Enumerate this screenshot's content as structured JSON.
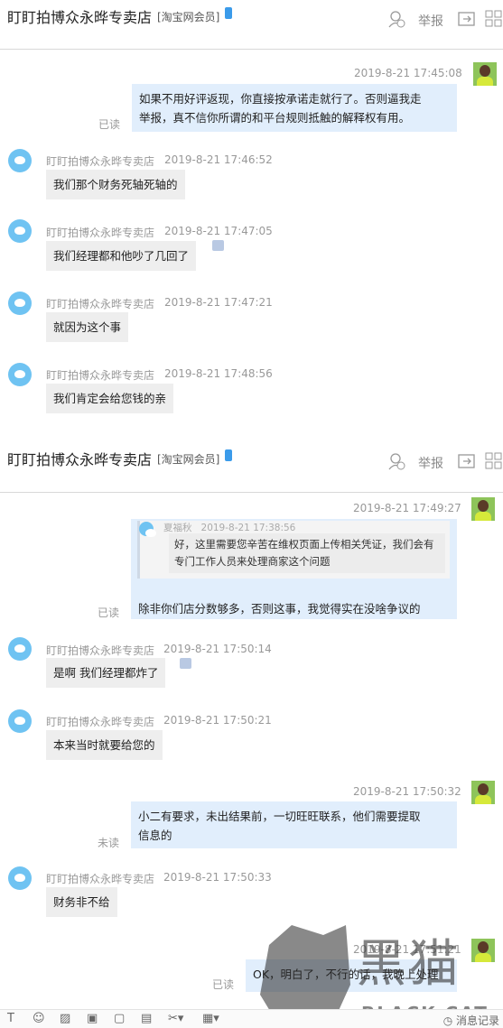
{
  "header": {
    "shop_name": "盯盯拍博众永晔专卖店",
    "member_badge": "[淘宝网会员]",
    "report_label": "举报"
  },
  "messages1": {
    "m1": {
      "time": "2019-8-21 17:45:08",
      "text1": "如果不用好评返现，你直接按承诺走就行了。否则逼我走",
      "text2": "举报，真不信你所谓的和平台规则抵触的解释权有用。",
      "status": "已读"
    },
    "m2": {
      "sender": "盯盯拍博众永晔专卖店",
      "time": "2019-8-21 17:46:52",
      "text": "我们那个财务死轴死轴的"
    },
    "m3": {
      "sender": "盯盯拍博众永晔专卖店",
      "time": "2019-8-21 17:47:05",
      "text": "我们经理都和他吵了几回了"
    },
    "m4": {
      "sender": "盯盯拍博众永晔专卖店",
      "time": "2019-8-21 17:47:21",
      "text": "就因为这个事"
    },
    "m5": {
      "sender": "盯盯拍博众永晔专卖店",
      "time": "2019-8-21 17:48:56",
      "text": "我们肯定会给您钱的亲"
    }
  },
  "messages2": {
    "m6": {
      "time": "2019-8-21 17:49:27",
      "quote_sender": "夏福秋",
      "quote_time": "2019-8-21 17:38:56",
      "quote_text1": "好，这里需要您辛苦在维权页面上传相关凭证，我们会有",
      "quote_text2": "专门工作人员来处理商家这个问题",
      "text": "除非你们店分数够多，否则这事，我觉得实在没啥争议的",
      "status": "已读"
    },
    "m7": {
      "sender": "盯盯拍博众永晔专卖店",
      "time": "2019-8-21 17:50:14",
      "text": "是啊 我们经理都炸了"
    },
    "m8": {
      "sender": "盯盯拍博众永晔专卖店",
      "time": "2019-8-21 17:50:21",
      "text": "本来当时就要给您的"
    },
    "m9": {
      "time": "2019-8-21 17:50:32",
      "text1": "小二有要求，未出结果前，一切旺旺联系，他们需要提取",
      "text2": "信息的",
      "status": "未读"
    },
    "m10": {
      "sender": "盯盯拍博众永晔专卖店",
      "time": "2019-8-21 17:50:33",
      "text": "财务非不给"
    },
    "m11": {
      "time": "2019-8-21 17:51:21",
      "text": "OK，明白了，不行的话，我晚上处理",
      "status": "已读"
    }
  },
  "toolbar": {
    "history_label": "消息记录"
  },
  "watermark": {
    "cn": "黑猫",
    "en": "BLACK CAT"
  }
}
